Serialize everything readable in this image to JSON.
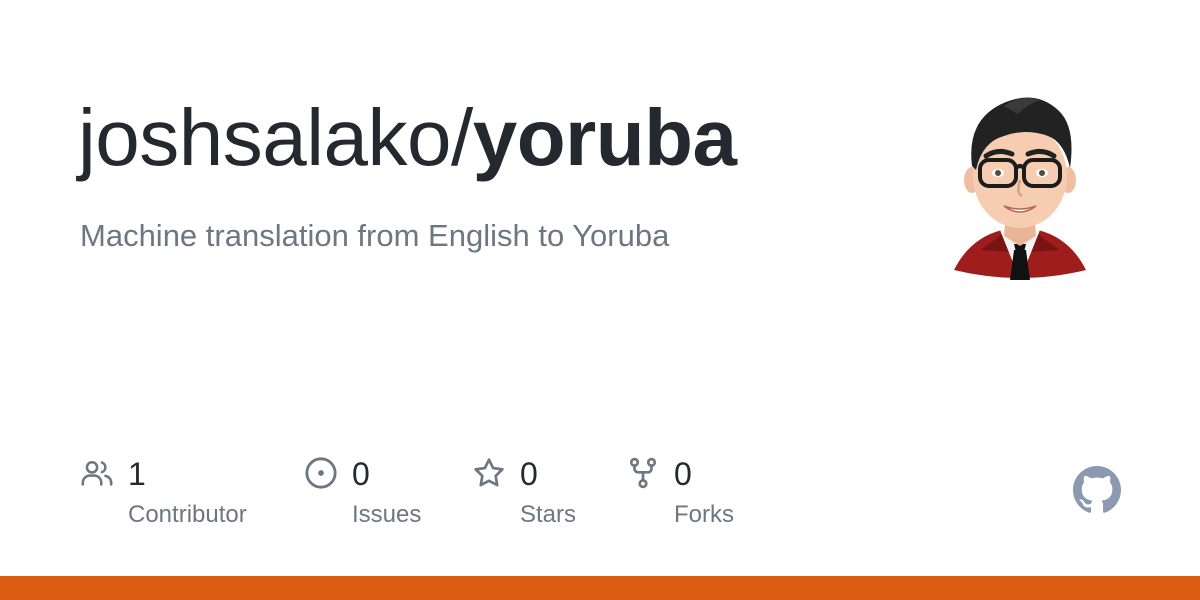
{
  "repo": {
    "owner": "joshsalako/",
    "name": "yoruba",
    "description": "Machine translation from English to Yoruba"
  },
  "stats": {
    "contributors": {
      "value": "1",
      "label": "Contributor",
      "icon": "people-icon"
    },
    "issues": {
      "value": "0",
      "label": "Issues",
      "icon": "issue-opened-icon"
    },
    "stars": {
      "value": "0",
      "label": "Stars",
      "icon": "star-icon"
    },
    "forks": {
      "value": "0",
      "label": "Forks",
      "icon": "repo-forked-icon"
    }
  },
  "colors": {
    "title": "#24292f",
    "muted": "#6e7781",
    "icon": "#6e7781",
    "github_logo": "#8b9ab0",
    "language_bar": "#dc5b12"
  },
  "avatar": {
    "icon": "cartoon-avatar"
  },
  "logo": {
    "icon": "github-mark-icon"
  }
}
